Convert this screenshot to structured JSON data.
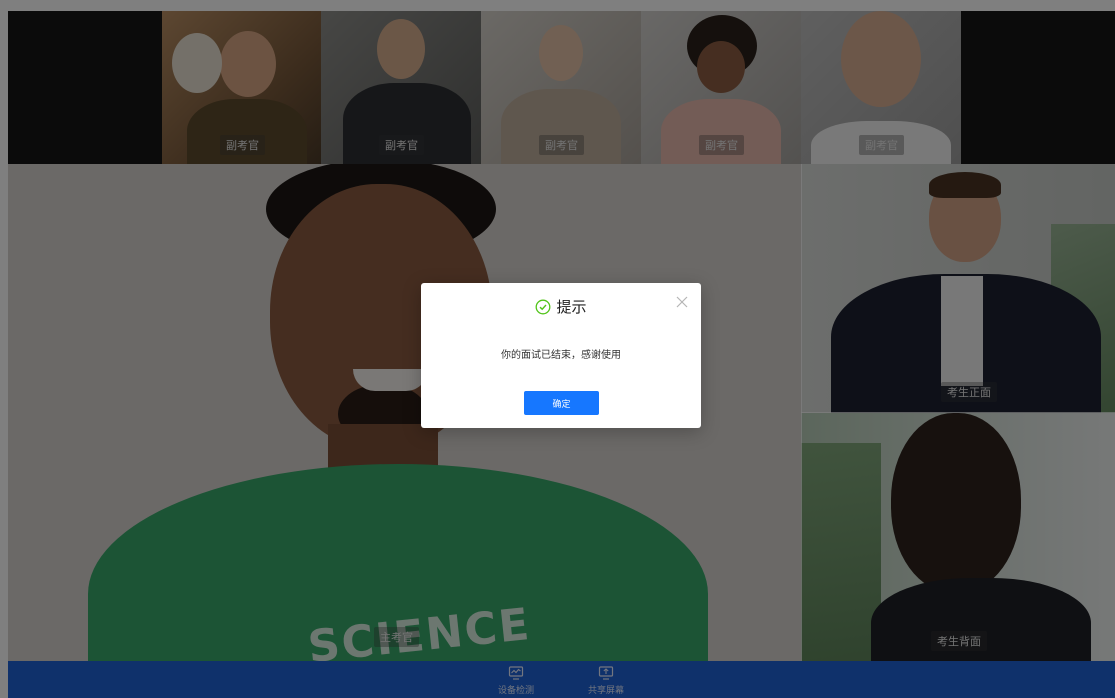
{
  "examiners": {
    "tiles": [
      {
        "label": "副考官"
      },
      {
        "label": "副考官"
      },
      {
        "label": "副考官"
      },
      {
        "label": "副考官"
      },
      {
        "label": "副考官"
      }
    ]
  },
  "main_video": {
    "label": "主考官"
  },
  "candidate_front": {
    "label": "考生正面"
  },
  "candidate_back": {
    "label": "考生背面"
  },
  "toolbar": {
    "device_check_label": "设备检测",
    "device_check_icon": "monitor-wave-icon",
    "share_screen_label": "共享屏幕",
    "share_screen_icon": "screen-share-icon"
  },
  "dialog": {
    "title": "提示",
    "title_icon": "check-circle-icon",
    "message": "你的面试已结束，感谢使用",
    "confirm_label": "确定",
    "close_icon": "close-icon"
  },
  "colors": {
    "toolbar": "#1f63d6",
    "primary_button": "#1677ff",
    "success_icon": "#52c41a"
  }
}
